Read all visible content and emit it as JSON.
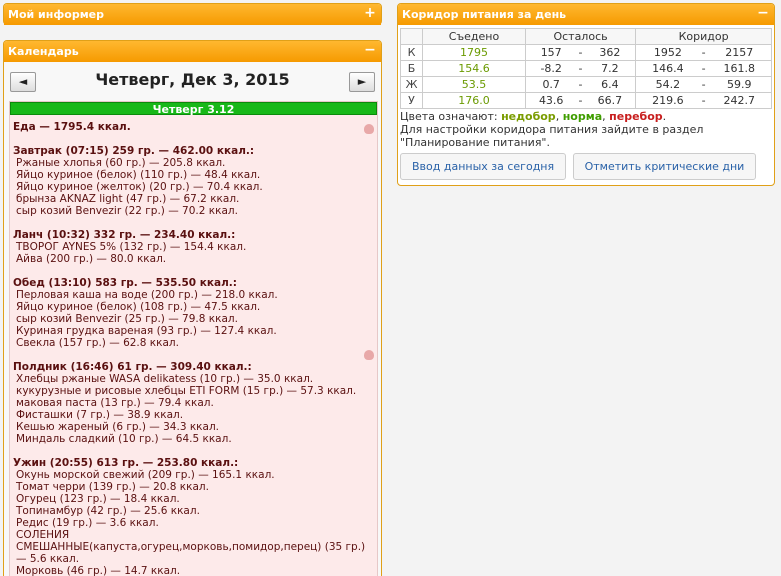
{
  "informer": {
    "title": "Мой информер",
    "toggle": "+"
  },
  "calendar": {
    "title": "Календарь",
    "toggle": "−",
    "prev": "◄",
    "next": "►",
    "date_title": "Четверг, Дек 3, 2015",
    "day_bar": "Четверг 3.12",
    "total": "Еда — 1795.4 ккал.",
    "meals": [
      {
        "head": "Завтрак (07:15) 259 гр. — 462.00 ккал.:",
        "items": [
          "Ржаные хлопья (60 гр.) — 205.8 ккал.",
          "Яйцо куриное (белок) (110 гр.) — 48.4 ккал.",
          "Яйцо куриное (желток) (20 гр.) — 70.4 ккал.",
          "брынза AKNAZ light (47 гр.) — 67.2 ккал.",
          "сыр козий Benvezir (22 гр.) — 70.2 ккал."
        ]
      },
      {
        "head": "Ланч (10:32) 332 гр. — 234.40 ккал.:",
        "items": [
          "ТВОРОГ AYNES 5% (132 гр.) — 154.4 ккал.",
          "Айва (200 гр.) — 80.0 ккал."
        ]
      },
      {
        "head": "Обед (13:10) 583 гр. — 535.50 ккал.:",
        "items": [
          "Перловая каша на воде (200 гр.) — 218.0 ккал.",
          "Яйцо куриное (белок) (108 гр.) — 47.5 ккал.",
          "сыр козий Benvezir (25 гр.) — 79.8 ккал.",
          "Куриная грудка вареная (93 гр.) — 127.4 ккал.",
          "Свекла (157 гр.) — 62.8 ккал."
        ]
      },
      {
        "head": "Полдник (16:46) 61 гр. — 309.40 ккал.:",
        "items": [
          "Хлебцы ржаные WASA delikatess (10 гр.) — 35.0 ккал.",
          "кукурузные и рисовые хлебцы ETI FORM (15 гр.) — 57.3 ккал.",
          "маковая паста (13 гр.) — 79.4 ккал.",
          "Фисташки (7 гр.) — 38.9 ккал.",
          "Кешью жареный (6 гр.) — 34.3 ккал.",
          "Миндаль сладкий (10 гр.) — 64.5 ккал."
        ]
      },
      {
        "head": "Ужин (20:55) 613 гр. — 253.80 ккал.:",
        "items": [
          "Окунь морской свежий (209 гр.) — 165.1 ккал.",
          "Томат черри (139 гр.) — 20.8 ккал.",
          "Огурец (123 гр.) — 18.4 ккал.",
          "Топинамбур (42 гр.) — 25.6 ккал.",
          "Редис (19 гр.) — 3.6 ккал.",
          "СОЛЕНИЯ СМЕШАННЫЕ(капуста,огурец,морковь,помидор,перец) (35 гр.) — 5.6 ккал.",
          "Морковь (46 гр.) — 14.7 ккал."
        ]
      }
    ]
  },
  "corridor": {
    "title": "Коридор питания за день",
    "toggle": "−",
    "headers": [
      "",
      "Съедено",
      "Осталось",
      "Коридор"
    ],
    "rows": [
      {
        "label": "К",
        "eaten": "1795",
        "rem_min": "157",
        "rem_max": "362",
        "cor_min": "1952",
        "cor_max": "2157"
      },
      {
        "label": "Б",
        "eaten": "154.6",
        "rem_min": "-8.2",
        "rem_max": "7.2",
        "cor_min": "146.4",
        "cor_max": "161.8"
      },
      {
        "label": "Ж",
        "eaten": "53.5",
        "rem_min": "0.7",
        "rem_max": "6.4",
        "cor_min": "54.2",
        "cor_max": "59.9"
      },
      {
        "label": "У",
        "eaten": "176.0",
        "rem_min": "43.6",
        "rem_max": "66.7",
        "cor_min": "219.6",
        "cor_max": "242.7"
      }
    ],
    "dash": "-",
    "legend_prefix": "Цвета означают:",
    "legend_low": "недобор",
    "legend_ok": "норма",
    "legend_over": "перебор",
    "sep": ",",
    "end": ".",
    "note": "Для настройки коридора питания зайдите в раздел \"Планирование питания\".",
    "btn_enter": "Ввод данных за сегодня",
    "btn_critical": "Отметить критические дни"
  },
  "colors": {
    "accent": "#f69a00",
    "green_bar": "#18b818",
    "day_bg": "#fdeaea"
  }
}
